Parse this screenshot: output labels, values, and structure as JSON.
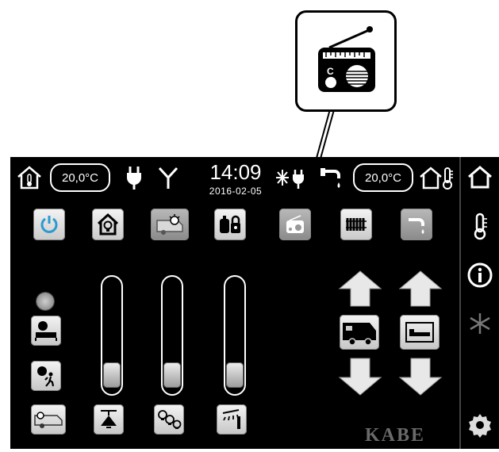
{
  "header": {
    "inside_temp": "20,0°C",
    "outside_temp": "20,0°C",
    "time": "14:09",
    "date": "2016-02-05"
  },
  "toolbar": {
    "items": [
      {
        "name": "power",
        "icon": "power-icon"
      },
      {
        "name": "home-light",
        "icon": "house-bulb-icon"
      },
      {
        "name": "caravan-light",
        "icon": "caravan-bulb-icon"
      },
      {
        "name": "gas-lock",
        "icon": "gas-lock-icon"
      },
      {
        "name": "radio",
        "icon": "radio-icon"
      },
      {
        "name": "heater",
        "icon": "radiator-icon"
      },
      {
        "name": "water",
        "icon": "faucet-icon"
      }
    ]
  },
  "sliders": [
    {
      "name": "ceiling-lamp",
      "level": 0.05
    },
    {
      "name": "spot-lights",
      "level": 0.05
    },
    {
      "name": "awning-light",
      "level": 0.05
    }
  ],
  "sidebar": {
    "items": [
      "home-icon",
      "thermometer-icon",
      "info-icon",
      "snowflake-icon",
      "gear-icon"
    ]
  },
  "brand": "KABE",
  "colors": {
    "panel": "#000000",
    "button_light": "#e6e6e6",
    "text": "#ffffff"
  }
}
